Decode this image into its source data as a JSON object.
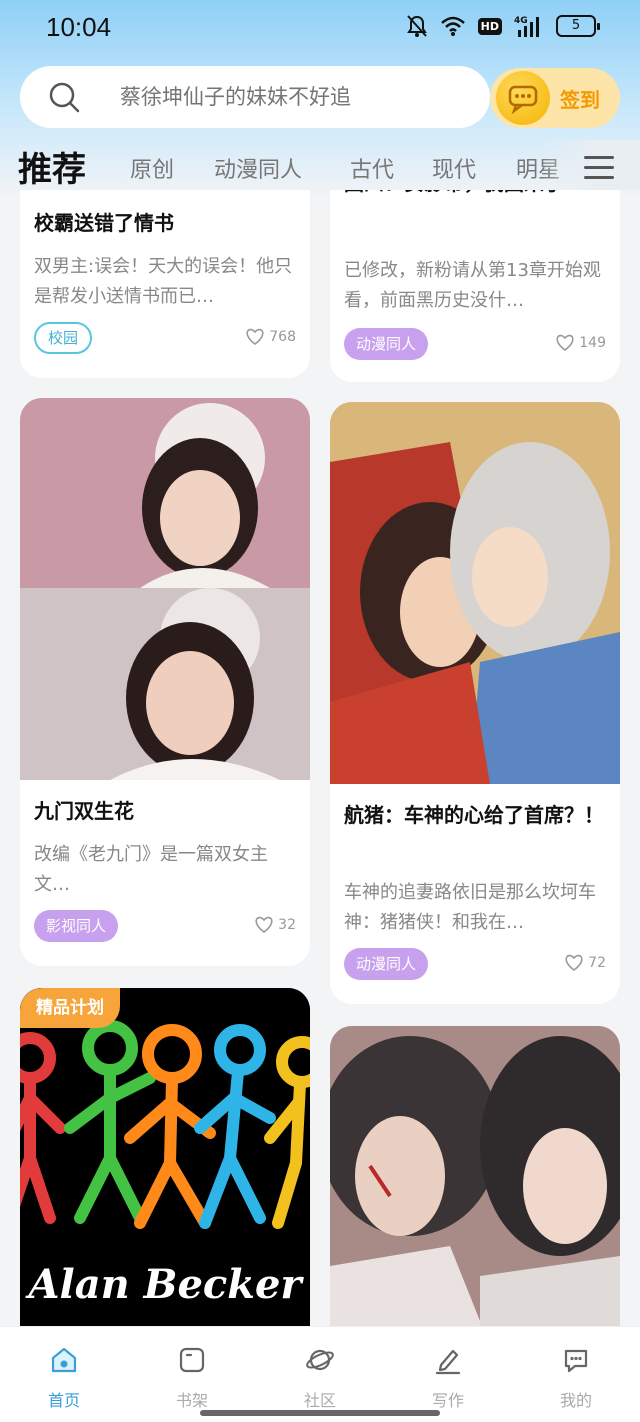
{
  "status_bar": {
    "time": "10:04",
    "network": "4G",
    "hd": "HD",
    "battery": "5"
  },
  "search": {
    "placeholder": "蔡徐坤仙子的妹妹不好追"
  },
  "signin": {
    "label": "签到"
  },
  "tabs": {
    "active": "推荐",
    "items": [
      "原创",
      "动漫同人",
      "古代",
      "现代",
      "明星"
    ]
  },
  "cards": [
    {
      "title": "校霸送错了情书",
      "desc": "双男主:误会！天大的误会！他只是帮发小送情书而已…",
      "tag": "校园",
      "likes": "768"
    },
    {
      "title": "回四：安影帝，我回来了",
      "desc": "已修改，新粉请从第13章开始观看，前面黑历史没什…",
      "tag": "动漫同人",
      "likes": "149"
    },
    {
      "title": "九门双生花",
      "desc": "改编《老九门》是一篇双女主文…",
      "tag": "影视同人",
      "likes": "32"
    },
    {
      "title": "航猪：车神的心给了首席？！",
      "desc": "车神的追妻路依旧是那么坎坷车神：猪猪侠！和我在…",
      "tag": "动漫同人",
      "likes": "72"
    },
    {
      "badge": "精品计划",
      "cover_text": "Alan Becker"
    },
    {}
  ],
  "bottom_nav": [
    {
      "label": "首页",
      "icon": "home-icon",
      "active": true
    },
    {
      "label": "书架",
      "icon": "bookshelf-icon"
    },
    {
      "label": "社区",
      "icon": "planet-icon"
    },
    {
      "label": "写作",
      "icon": "pen-icon"
    },
    {
      "label": "我的",
      "icon": "chat-bubble-icon"
    }
  ],
  "colors": {
    "accent": "#3a9fd8",
    "tag_purple": "#c8a1ee",
    "tag_cyan": "#55c7e1",
    "premium": "#f7a53a",
    "signin_bg": "#fde4a9"
  }
}
